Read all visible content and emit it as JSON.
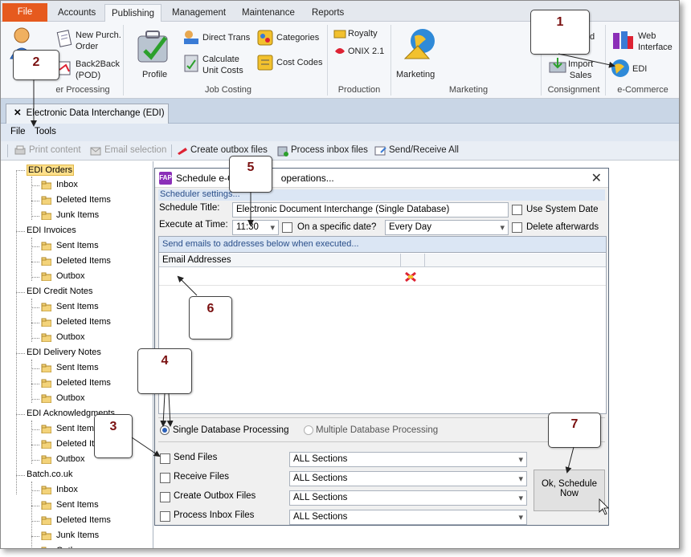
{
  "ribbon_tabs": [
    "File",
    "Accounts",
    "Publishing",
    "Management",
    "Maintenance",
    "Reports"
  ],
  "ribbon": {
    "new_purch_order": "New Purch.\nOrder",
    "back2back": "Back2Back\n(POD)",
    "group_processing": "er Processing",
    "profile": "Profile",
    "direct_trans": "Direct Trans",
    "calc_unit_costs": "Calculate\nUnit Costs",
    "categories": "Categories",
    "cost_codes": "Cost Codes",
    "group_job_costing": "Job Costing",
    "royalty": "Royalty",
    "onix": "ONIX 2.1",
    "group_production": "Production",
    "marketing_btn": "Marketing",
    "group_marketing": "Marketing",
    "cons_partial": "d",
    "import_sales": "Import\nSales",
    "group_consignment": "Consignment",
    "web_interface": "Web\nInterface",
    "edi": "EDI",
    "group_ecommerce": "e-Commerce"
  },
  "doc_tab": {
    "close": "✕",
    "title": "Electronic Data Interchange (EDI)"
  },
  "menu": {
    "file": "File",
    "tools": "Tools"
  },
  "toolbar": {
    "print": "Print content",
    "email": "Email selection",
    "create_outbox": "Create outbox files",
    "process_inbox": "Process inbox files",
    "send_receive": "Send/Receive All"
  },
  "tree": [
    {
      "label": "EDI Orders",
      "children": [
        "Inbox",
        "Deleted Items",
        "Junk Items"
      ]
    },
    {
      "label": "EDI Invoices",
      "children": [
        "Sent Items",
        "Deleted Items",
        "Outbox"
      ]
    },
    {
      "label": "EDI Credit Notes",
      "children": [
        "Sent Items",
        "Deleted Items",
        "Outbox"
      ]
    },
    {
      "label": "EDI Delivery Notes",
      "children": [
        "Sent Items",
        "Deleted Items",
        "Outbox"
      ]
    },
    {
      "label": "EDI Acknowledgments",
      "children": [
        "Sent Item",
        "Deleted It",
        "Outbox"
      ]
    },
    {
      "label": "Batch.co.uk",
      "children": [
        "Inbox",
        "Sent Items",
        "Deleted Items",
        "Junk Items",
        "Outbox"
      ]
    }
  ],
  "dialog": {
    "title": "Schedule e-C",
    "title_tail": "operations...",
    "close": "✕",
    "section": "Scheduler settings...",
    "schedule_title_label": "Schedule Title:",
    "schedule_title_value": "Electronic Document Interchange (Single Database)",
    "use_system_date": "Use System Date",
    "execute_label": "Execute at Time:",
    "time_value": "11:30",
    "specific_date": "On a specific date?",
    "frequency": "Every Day",
    "delete_afterwards": "Delete afterwards",
    "email_header": "Send emails to addresses below when executed...",
    "email_col": "Email Addresses",
    "single_db": "Single Database Processing",
    "multi_db": "Multiple Database Processing",
    "tasks": [
      {
        "label": "Send Files",
        "section": "ALL Sections"
      },
      {
        "label": "Receive Files",
        "section": "ALL Sections"
      },
      {
        "label": "Create Outbox Files",
        "section": "ALL Sections"
      },
      {
        "label": "Process Inbox Files",
        "section": "ALL Sections"
      }
    ],
    "ok_button": "Ok, Schedule\nNow"
  },
  "callouts": [
    "1",
    "2",
    "3",
    "4",
    "5",
    "6",
    "7"
  ],
  "colors": {
    "file_tab": "#e65a1e",
    "selection": "#ffe08a",
    "callout_text": "#7a1010",
    "section_text": "#2a4f8a"
  }
}
